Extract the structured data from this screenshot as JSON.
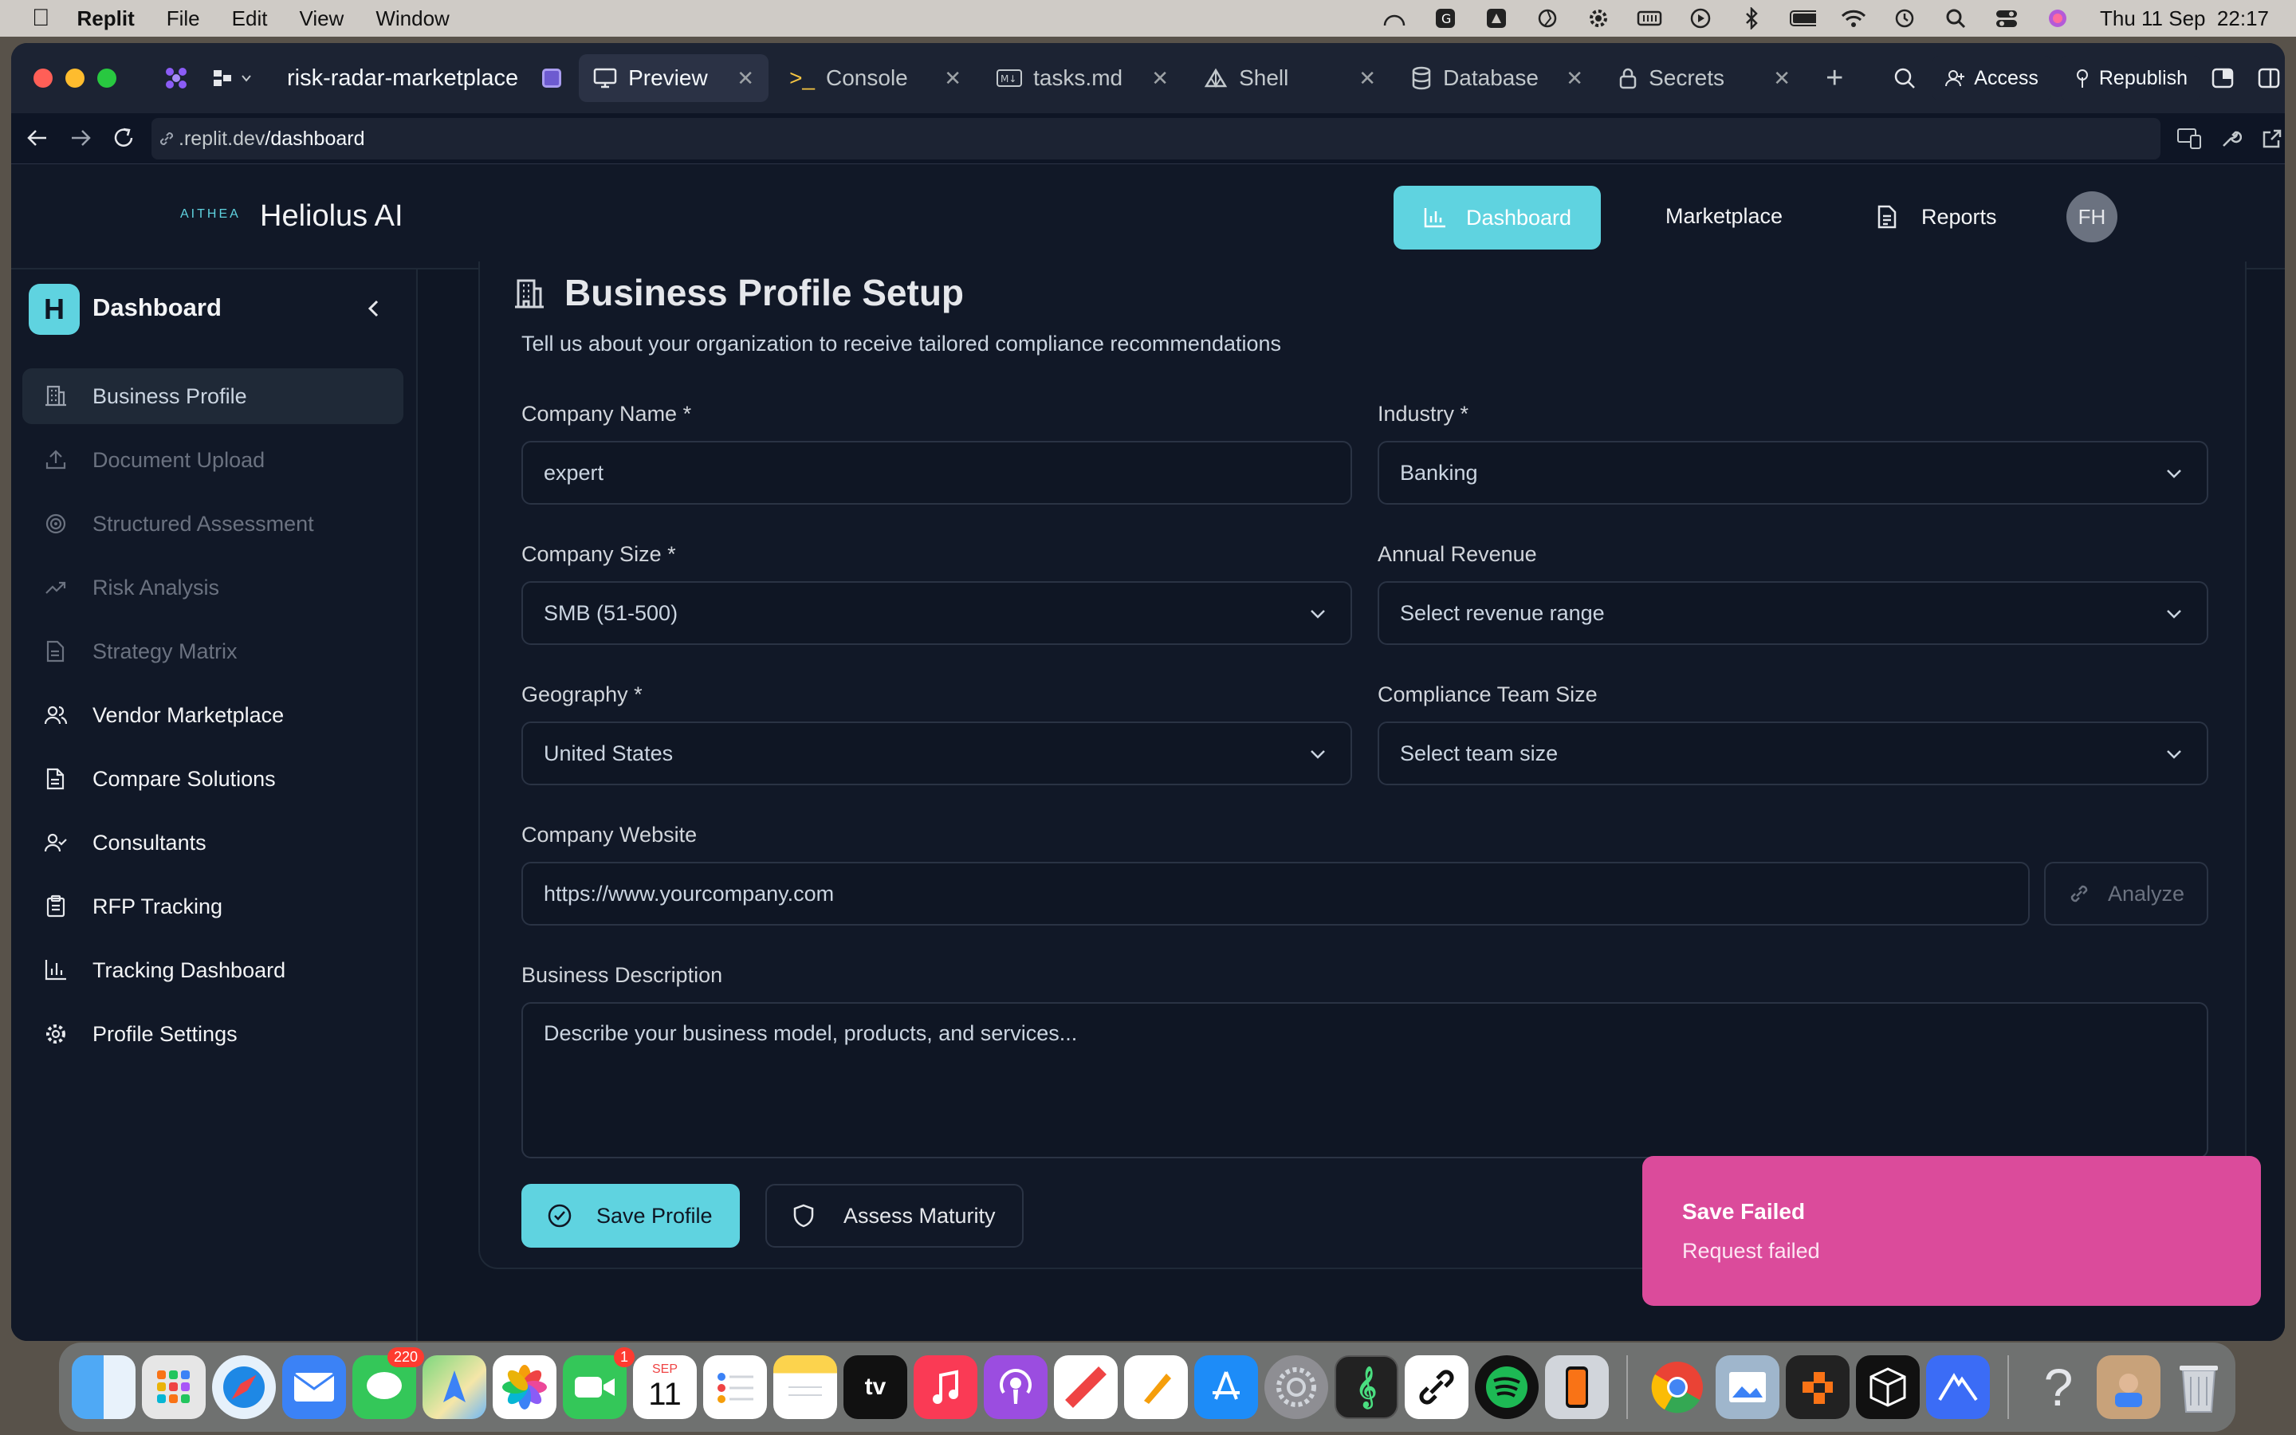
{
  "menubar": {
    "app_name": "Replit",
    "items": [
      "File",
      "Edit",
      "View",
      "Window"
    ],
    "clock": "Thu 11 Sep  22:17"
  },
  "tabs": {
    "project": "risk-radar-marketplace",
    "items": [
      {
        "label": "Preview",
        "icon": "monitor-icon"
      },
      {
        "label": "Console",
        "icon": "terminal-icon"
      },
      {
        "label": "tasks.md",
        "icon": "markdown-icon"
      },
      {
        "label": "Shell",
        "icon": "shell-icon"
      },
      {
        "label": "Database",
        "icon": "database-icon"
      },
      {
        "label": "Secrets",
        "icon": "lock-icon"
      }
    ],
    "access_label": "Access",
    "republish_label": "Republish"
  },
  "url": {
    "prefix": ".replit.dev",
    "path": "/dashboard"
  },
  "topnav": {
    "logo_small": "AITHEA",
    "brand": "Heliolus AI",
    "dashboard": "Dashboard",
    "marketplace": "Marketplace",
    "reports": "Reports",
    "avatar": "FH"
  },
  "sidebar": {
    "logo_letter": "H",
    "title": "Dashboard",
    "items": [
      {
        "label": "Business Profile",
        "icon": "building-icon",
        "state": "active"
      },
      {
        "label": "Document Upload",
        "icon": "upload-icon",
        "state": "dim"
      },
      {
        "label": "Structured Assessment",
        "icon": "target-icon",
        "state": "dim"
      },
      {
        "label": "Risk Analysis",
        "icon": "trending-up-icon",
        "state": "dim"
      },
      {
        "label": "Strategy Matrix",
        "icon": "file-icon",
        "state": "dim"
      },
      {
        "label": "Vendor Marketplace",
        "icon": "users-icon",
        "state": "normal"
      },
      {
        "label": "Compare Solutions",
        "icon": "document-icon",
        "state": "normal"
      },
      {
        "label": "Consultants",
        "icon": "user-check-icon",
        "state": "normal"
      },
      {
        "label": "RFP Tracking",
        "icon": "clipboard-icon",
        "state": "normal"
      },
      {
        "label": "Tracking Dashboard",
        "icon": "bar-chart-icon",
        "state": "normal"
      },
      {
        "label": "Profile Settings",
        "icon": "gear-icon",
        "state": "normal"
      }
    ]
  },
  "form": {
    "title": "Business Profile Setup",
    "subtitle": "Tell us about your organization to receive tailored compliance recommendations",
    "company_name_label": "Company Name *",
    "company_name_value": "expert",
    "industry_label": "Industry *",
    "industry_value": "Banking",
    "company_size_label": "Company Size *",
    "company_size_value": "SMB (51-500)",
    "annual_revenue_label": "Annual Revenue",
    "annual_revenue_placeholder": "Select revenue range",
    "geography_label": "Geography *",
    "geography_value": "United States",
    "team_size_label": "Compliance Team Size",
    "team_size_placeholder": "Select team size",
    "website_label": "Company Website",
    "website_placeholder": "https://www.yourcompany.com",
    "analyze_label": "Analyze",
    "description_label": "Business Description",
    "description_placeholder": "Describe your business model, products, and services...",
    "save_label": "Save Profile",
    "assess_label": "Assess Maturity"
  },
  "toast": {
    "title": "Save Failed",
    "message": "Request failed"
  },
  "dock": {
    "messages_badge": "220",
    "facetime_badge": "1",
    "calendar_month": "SEP",
    "calendar_day": "11",
    "tv_label": "tv"
  },
  "colors": {
    "accent": "#5fd3e0",
    "toast": "#db4b9b",
    "background": "#0f1624"
  }
}
